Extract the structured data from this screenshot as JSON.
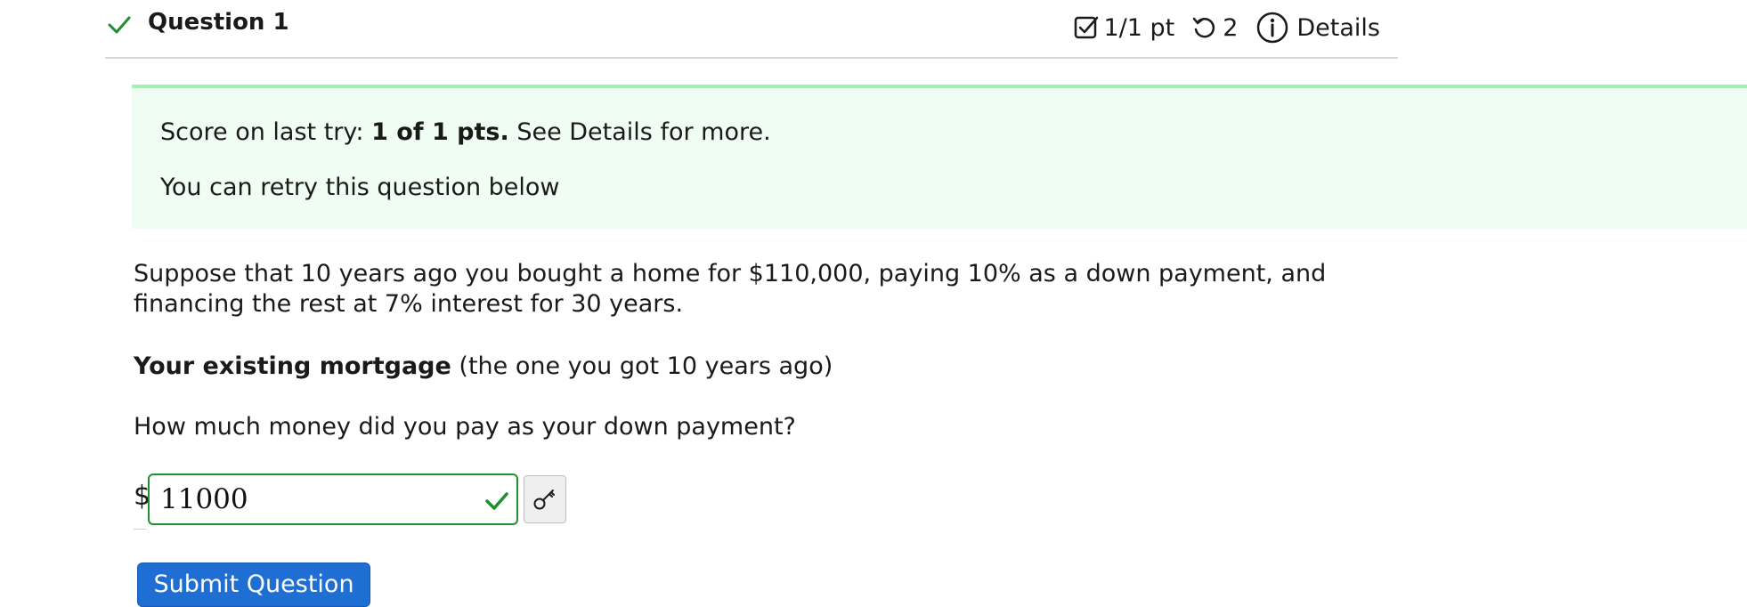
{
  "header": {
    "title": "Question 1",
    "points": "1/1 pt",
    "attempts": "2",
    "details_label": "Details",
    "status_icon": "check-icon",
    "accent_color": "#1f8f2f"
  },
  "score_banner": {
    "prefix": "Score on last try: ",
    "score": "1 of 1 pts.",
    "suffix": " See Details for more.",
    "retry_text": "You can retry this question below",
    "background": "#f0fdf2",
    "border_color": "#a3f0b0"
  },
  "problem": {
    "text": "Suppose that 10 years ago you bought a home for $110,000, paying 10% as a down payment, and financing the rest at 7% interest for 30 years.",
    "section_bold": "Your existing mortgage",
    "section_rest": " (the one you got 10 years ago)",
    "question": "How much money did you pay as your down payment?"
  },
  "answer": {
    "currency": "$",
    "value": "11000",
    "status": "correct"
  },
  "submit_label": "Submit Question"
}
